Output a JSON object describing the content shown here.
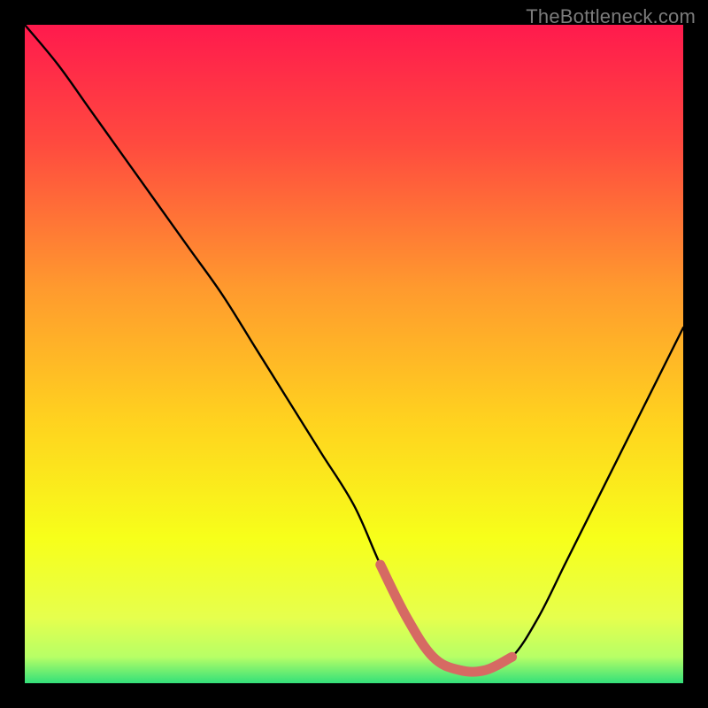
{
  "watermark": "TheBottleneck.com",
  "chart_data": {
    "type": "line",
    "title": "",
    "xlabel": "",
    "ylabel": "",
    "xlim": [
      0,
      100
    ],
    "ylim": [
      0,
      100
    ],
    "series": [
      {
        "name": "curve",
        "color": "#000000",
        "x": [
          0,
          5,
          10,
          15,
          20,
          25,
          30,
          35,
          40,
          45,
          50,
          54,
          58,
          62,
          66,
          70,
          74,
          78,
          82,
          86,
          90,
          94,
          98,
          100
        ],
        "values": [
          100,
          94,
          87,
          80,
          73,
          66,
          59,
          51,
          43,
          35,
          27,
          18,
          10,
          4,
          2,
          2,
          4,
          10,
          18,
          26,
          34,
          42,
          50,
          54
        ]
      },
      {
        "name": "highlight",
        "color": "#d66a63",
        "x": [
          54,
          58,
          62,
          66,
          70,
          74
        ],
        "values": [
          18,
          10,
          4,
          2,
          2,
          4
        ]
      }
    ],
    "gradient_stops": [
      {
        "offset": 0.0,
        "color": "#ff1a4d"
      },
      {
        "offset": 0.18,
        "color": "#ff4a3f"
      },
      {
        "offset": 0.4,
        "color": "#ff9a2e"
      },
      {
        "offset": 0.6,
        "color": "#ffd21f"
      },
      {
        "offset": 0.78,
        "color": "#f7ff1a"
      },
      {
        "offset": 0.9,
        "color": "#e6ff4d"
      },
      {
        "offset": 0.96,
        "color": "#b7ff66"
      },
      {
        "offset": 1.0,
        "color": "#33e07a"
      }
    ]
  }
}
